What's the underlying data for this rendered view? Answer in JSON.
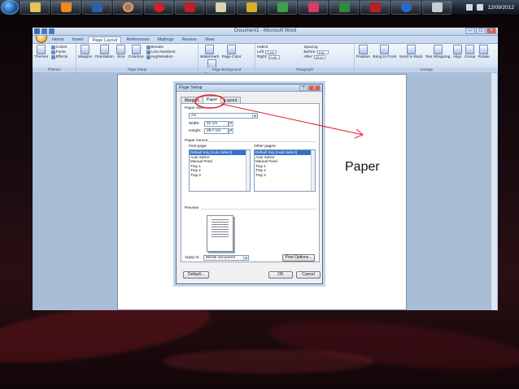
{
  "taskbar": {
    "clock": "12/09/2012",
    "apps": [
      "explorer",
      "vlc",
      "word",
      "chrome",
      "opera",
      "filezilla",
      "photos",
      "winamp",
      "paint",
      "excel",
      "powerpoint",
      "photoshop",
      "help",
      "scanner"
    ]
  },
  "word": {
    "title": "Document1 - Microsoft Word",
    "tabs": [
      "Home",
      "Insert",
      "Page Layout",
      "References",
      "Mailings",
      "Review",
      "View"
    ],
    "active_tab": "Page Layout",
    "ribbon": {
      "themes": {
        "big": "Themes",
        "colors": "Colors",
        "fonts": "Fonts",
        "effects": "Effects",
        "label": "Themes"
      },
      "page_setup": {
        "margins": "Margins",
        "orientation": "Orientation",
        "size": "Size",
        "columns": "Columns",
        "breaks": "Breaks",
        "line_numbers": "Line Numbers",
        "hyphenation": "Hyphenation",
        "label": "Page Setup"
      },
      "page_background": {
        "watermark": "Watermark",
        "page_color": "Page Color",
        "page_borders": "Page Borders",
        "label": "Page Background"
      },
      "paragraph": {
        "indent": "Indent",
        "left": "Left:",
        "right": "Right:",
        "left_val": "0 cm",
        "right_val": "0 cm",
        "spacing": "Spacing",
        "before": "Before:",
        "after": "After:",
        "before_val": "0 pt",
        "after_val": "10 pt",
        "label": "Paragraph"
      },
      "arrange": {
        "position": "Position",
        "bring_to_front": "Bring to Front",
        "send_to_back": "Send to Back",
        "text_wrapping": "Text Wrapping",
        "align": "Align",
        "group": "Group",
        "rotate": "Rotate",
        "label": "Arrange"
      }
    }
  },
  "dialog": {
    "title": "Page Setup",
    "help": "?",
    "close": "X",
    "tabs": [
      "Margins",
      "Paper",
      "Layout"
    ],
    "active_tab": "Paper",
    "paper_size_label": "Paper size:",
    "paper_size_value": "A4",
    "width_label": "Width:",
    "width_value": "21 cm",
    "height_label": "Height:",
    "height_value": "29.7 cm",
    "paper_source_label": "Paper source",
    "first_page_label": "First page:",
    "other_pages_label": "Other pages:",
    "first_page_items": [
      "Default tray (Auto Select)",
      "Auto Select",
      "Manual Feed",
      "Tray 1",
      "Tray 2",
      "Tray 3"
    ],
    "other_pages_items": [
      "Default tray (Auto Select)",
      "Auto Select",
      "Manual Feed",
      "Tray 1",
      "Tray 2",
      "Tray 3"
    ],
    "preview_label": "Preview",
    "apply_to_label": "Apply to:",
    "apply_to_value": "Whole document",
    "print_options": "Print Options...",
    "default_btn": "Default...",
    "ok_btn": "OK",
    "cancel_btn": "Cancel"
  },
  "annotation": {
    "label": "Paper",
    "color": "#e0202a"
  }
}
